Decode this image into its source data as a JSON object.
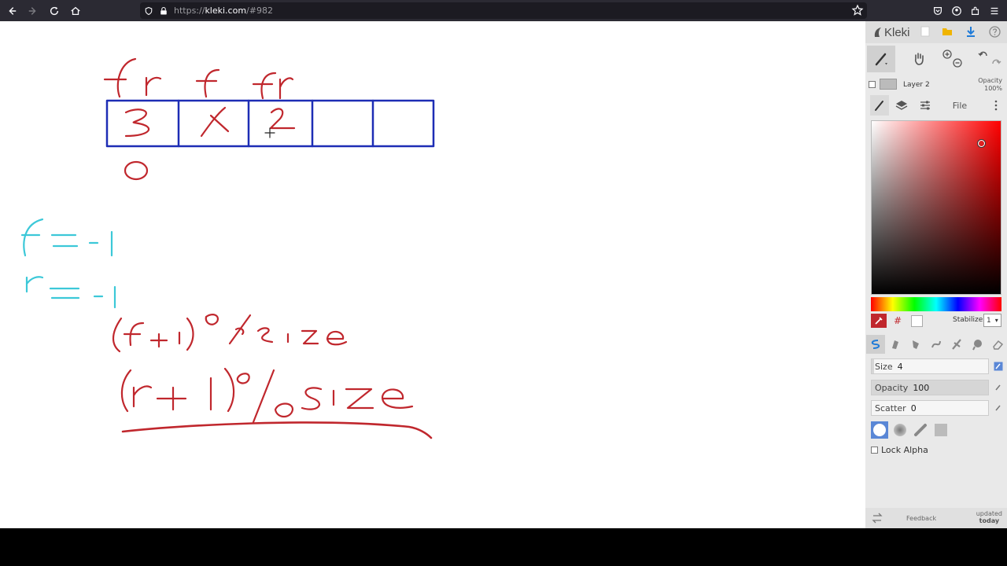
{
  "browser": {
    "url_scheme": "https://",
    "url_host": "kleki.com",
    "url_path": "/#982"
  },
  "panel": {
    "app_name": "Kleki",
    "layer": {
      "name": "Layer 2",
      "opacity_label": "Opacity",
      "opacity_value": "100%"
    },
    "tabs": {
      "file": "File"
    },
    "color": {
      "hex_symbol": "#",
      "stabilizer_label": "Stabilizer",
      "stabilizer_value": "1"
    },
    "sliders": [
      {
        "label": "Size",
        "value": "4",
        "fraction": 0.02
      },
      {
        "label": "Opacity",
        "value": "100",
        "fraction": 1.0
      },
      {
        "label": "Scatter",
        "value": "0",
        "fraction": 0.0
      }
    ],
    "lock_alpha": "Lock Alpha",
    "feedback": "Feedback",
    "updated": "updated",
    "updated_when": "today"
  },
  "colors": {
    "ink_red": "#c0272d",
    "ink_blue": "#1d2db5",
    "ink_cyan": "#3cc8d8",
    "accent": "#5a87d6"
  },
  "canvas": {
    "cells": 5,
    "icons": [
      "brush-icon",
      "hand-icon",
      "zoom-in-icon",
      "zoom-out-icon",
      "undo-icon",
      "redo-icon",
      "layers-icon",
      "adjust-icon",
      "menu-icon",
      "eyedropper-icon",
      "pen-icon",
      "blend-icon",
      "eraser-icon"
    ]
  }
}
